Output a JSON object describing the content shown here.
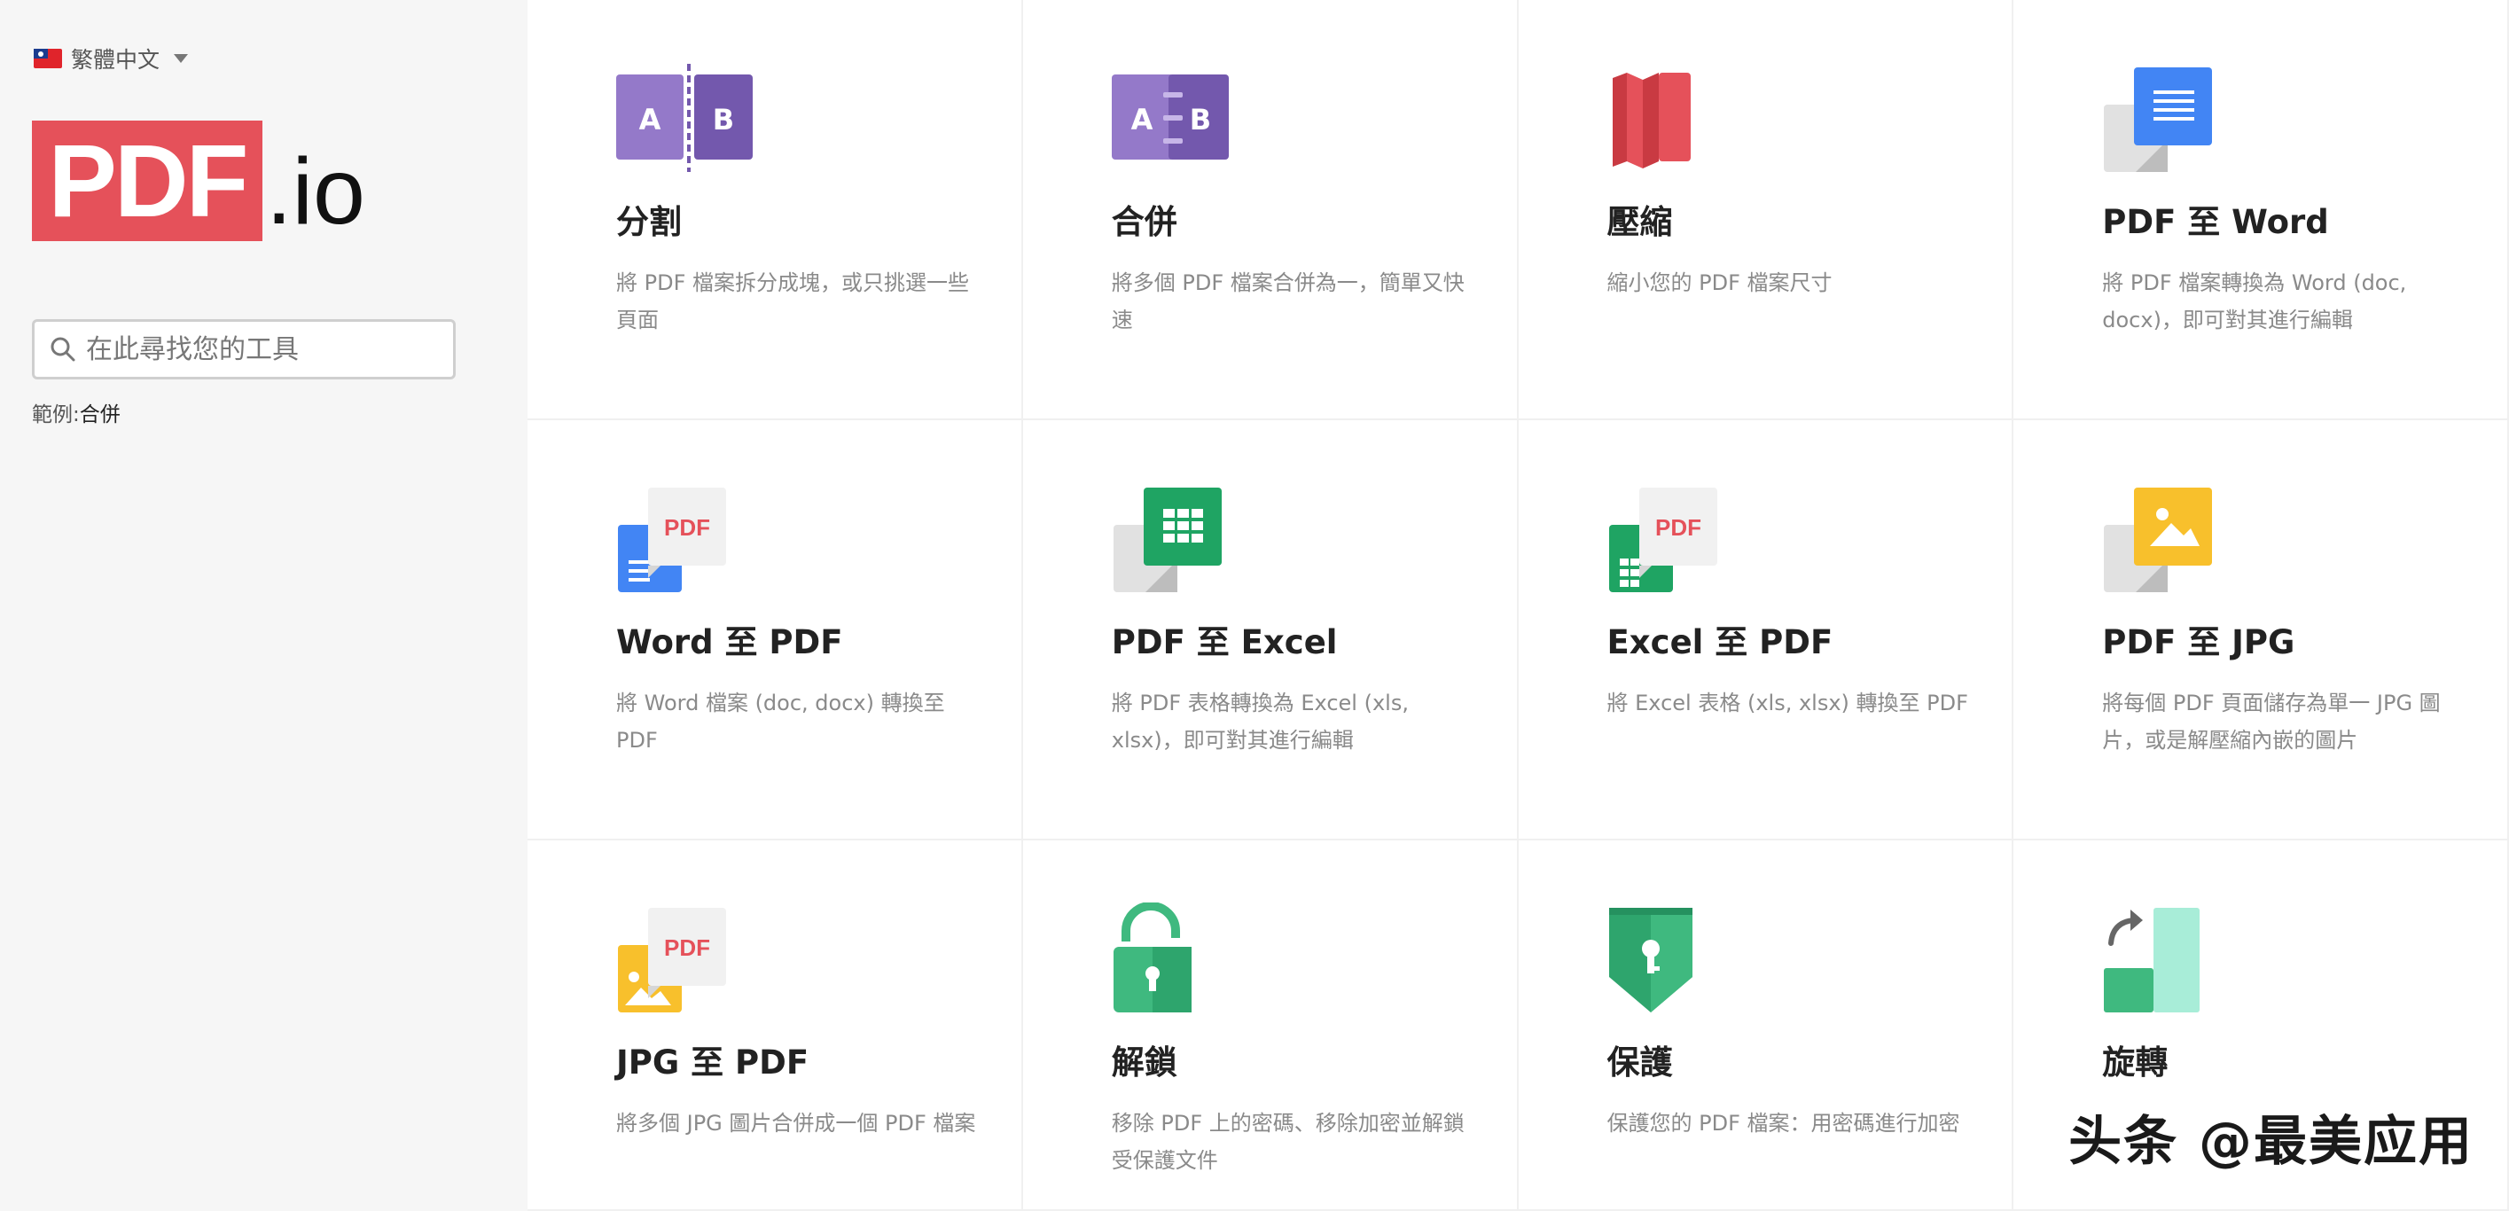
{
  "sidebar": {
    "language": "繁體中文",
    "logo_main": "PDF",
    "logo_suffix": ".io",
    "search_placeholder": "在此尋找您的工具",
    "example_label": "範例:",
    "example_link": "合併"
  },
  "tools": [
    {
      "title": "分割",
      "desc": "將 PDF 檔案拆分成塊，或只挑選一些頁面",
      "icon": "split-icon"
    },
    {
      "title": "合併",
      "desc": "將多個 PDF 檔案合併為一，簡單又快速",
      "icon": "merge-icon"
    },
    {
      "title": "壓縮",
      "desc": "縮小您的 PDF 檔案尺寸",
      "icon": "compress-icon"
    },
    {
      "title": "PDF 至 Word",
      "desc": "將 PDF 檔案轉換為 Word (doc, docx)，即可對其進行編輯",
      "icon": "pdf-to-word-icon"
    },
    {
      "title": "Word 至 PDF",
      "desc": "將 Word 檔案 (doc, docx) 轉換至 PDF",
      "icon": "word-to-pdf-icon"
    },
    {
      "title": "PDF 至 Excel",
      "desc": "將 PDF 表格轉換為 Excel (xls, xlsx)，即可對其進行編輯",
      "icon": "pdf-to-excel-icon"
    },
    {
      "title": "Excel 至 PDF",
      "desc": "將 Excel 表格 (xls, xlsx) 轉換至 PDF",
      "icon": "excel-to-pdf-icon"
    },
    {
      "title": "PDF 至 JPG",
      "desc": "將每個 PDF 頁面儲存為單一 JPG 圖片，或是解壓縮內嵌的圖片",
      "icon": "pdf-to-jpg-icon"
    },
    {
      "title": "JPG 至 PDF",
      "desc": "將多個 JPG 圖片合併成一個 PDF 檔案",
      "icon": "jpg-to-pdf-icon"
    },
    {
      "title": "解鎖",
      "desc": "移除 PDF 上的密碼、移除加密並解鎖受保護文件",
      "icon": "unlock-icon"
    },
    {
      "title": "保護",
      "desc": "保護您的 PDF 檔案：用密碼進行加密",
      "icon": "protect-icon"
    },
    {
      "title": "旋轉",
      "desc": "",
      "icon": "rotate-icon"
    }
  ],
  "icon_text": {
    "split_a": "A",
    "split_b": "B",
    "pdf_tag": "PDF"
  },
  "colors": {
    "brand_red": "#e5515a",
    "purple_light": "#9479c9",
    "purple_dark": "#7358ad",
    "word_blue": "#4285f4",
    "excel_green": "#1fa463",
    "jpg_yellow": "#f8c02c",
    "teal": "#3fb97f"
  },
  "watermark": "头条 @最美应用"
}
